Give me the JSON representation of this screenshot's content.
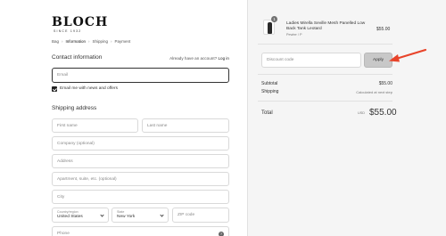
{
  "brand": {
    "name": "BLOCH",
    "tagline": "SINCE 1932"
  },
  "breadcrumb": [
    {
      "label": "Bag",
      "current": false
    },
    {
      "label": "Information",
      "current": true
    },
    {
      "label": "Shipping",
      "current": false
    },
    {
      "label": "Payment",
      "current": false
    }
  ],
  "contact": {
    "title": "Contact information",
    "login_prompt": "Already have an account?",
    "login_link": "Log in",
    "email_placeholder": "Email",
    "newsletter_label": "Email me with news and offers",
    "newsletter_checked": true
  },
  "shipping": {
    "title": "Shipping address",
    "first_name": "First name",
    "last_name": "Last name",
    "company": "Company (optional)",
    "address": "Address",
    "apartment": "Apartment, suite, etc. (optional)",
    "city": "City",
    "country_label": "Country/region",
    "country_value": "United States",
    "state_label": "State",
    "state_value": "New York",
    "zip": "ZIP code",
    "phone": "Phone",
    "help_icon": "?"
  },
  "cart": {
    "quantity": "1",
    "product_name": "Ladies Mirella Seville Mesh Panelled Low Back Tank Leotard",
    "variant": "Pewter / P",
    "price": "$55.00",
    "discount_placeholder": "Discount code",
    "apply_label": "Apply",
    "subtotal_label": "Subtotal",
    "subtotal_value": "$55.00",
    "shipping_label": "Shipping",
    "shipping_value": "Calculated at next step",
    "total_label": "Total",
    "total_currency": "USD",
    "total_value": "$55.00"
  },
  "colors": {
    "arrow": "#e8442a",
    "panel_bg": "#f5f5f5",
    "apply_bg": "#c8c8c8"
  }
}
